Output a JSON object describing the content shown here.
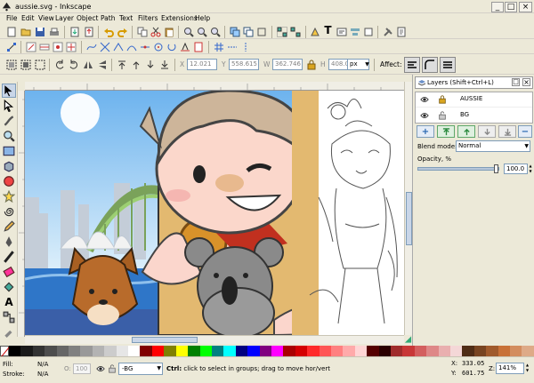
{
  "window": {
    "title": "aussie.svg - Inkscape",
    "min": "_",
    "max": "□",
    "close": "×"
  },
  "menu": [
    "File",
    "Edit",
    "View",
    "Layer",
    "Object",
    "Path",
    "Text",
    "Filters",
    "Extensions",
    "Help"
  ],
  "controls": {
    "x_label": "X",
    "x_value": "12.021",
    "y_label": "Y",
    "y_value": "558.615",
    "w_label": "W",
    "w_value": "362.746",
    "h_label": "H",
    "h_value": "408.001",
    "unit": "px",
    "affect_label": "Affect:"
  },
  "layers": {
    "tab_title": "Layers (Shift+Ctrl+L)",
    "items": [
      {
        "name": "AUSSIE"
      },
      {
        "name": "BG"
      }
    ],
    "blend_label": "Blend mode:",
    "blend_value": "Normal",
    "opacity_label": "Opacity, %",
    "opacity_value": "100.0",
    "opacity_level": 1.0
  },
  "palette_colors": [
    "#000000",
    "#1a1a1a",
    "#333333",
    "#4d4d4d",
    "#666666",
    "#808080",
    "#999999",
    "#b3b3b3",
    "#cccccc",
    "#e6e6e6",
    "#ffffff",
    "#800000",
    "#ff0000",
    "#808000",
    "#ffff00",
    "#008000",
    "#00ff00",
    "#008080",
    "#00ffff",
    "#000080",
    "#0000ff",
    "#800080",
    "#ff00ff",
    "#aa0000",
    "#d40000",
    "#ff2a2a",
    "#ff5555",
    "#ff8080",
    "#ffaaaa",
    "#ffd5d5",
    "#550000",
    "#2b0000",
    "#a02c2c",
    "#c83737",
    "#d35f5f",
    "#de8787",
    "#e9afaf",
    "#f4d7d7",
    "#502d16",
    "#784421",
    "#a05a2c",
    "#c87137",
    "#d38d5f",
    "#deaa87"
  ],
  "status": {
    "fill_label": "Fill:",
    "fill_value": "N/A",
    "stroke_label": "Stroke:",
    "stroke_value": "N/A",
    "o_label": "O:",
    "o_value": "100",
    "layer_value": "-BG",
    "message_bold": "Ctrl:",
    "message": " click to select in groups; drag to move hor/vert",
    "x_label": "X:",
    "x_value": "333.05",
    "y_label": "Y:",
    "y_value": "601.75",
    "zoom_label": "Z:",
    "zoom_value": "141%"
  }
}
